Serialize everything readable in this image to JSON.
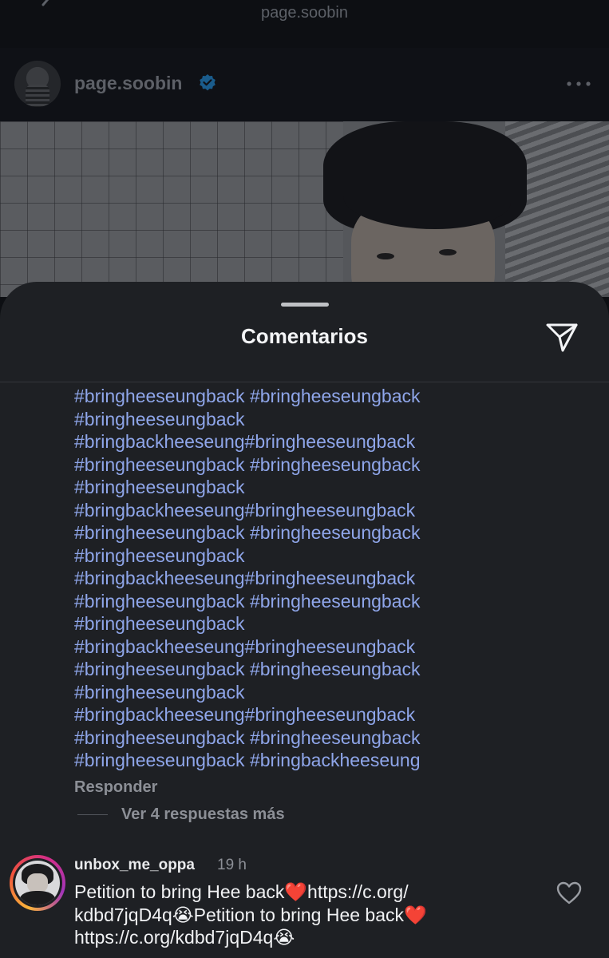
{
  "post": {
    "top_title": "page.soobin",
    "username": "page.soobin",
    "icons": {
      "back": "chevron-left-icon",
      "verified": "verified-badge-icon",
      "more": "more-options-icon"
    }
  },
  "comments_sheet": {
    "title": "Comentarios",
    "share_icon": "send-paper-plane-icon",
    "comment_1": {
      "lines": [
        "#bringheeseungback #bringheeseungback",
        "#bringheeseungback",
        "#bringbackheeseung#bringheeseungback",
        "#bringheeseungback #bringheeseungback",
        "#bringheeseungback",
        "#bringbackheeseung#bringheeseungback",
        "#bringheeseungback #bringheeseungback",
        "#bringheeseungback",
        "#bringbackheeseung#bringheeseungback",
        "#bringheeseungback #bringheeseungback",
        "#bringheeseungback",
        "#bringbackheeseung#bringheeseungback",
        "#bringheeseungback #bringheeseungback",
        "#bringheeseungback",
        "#bringbackheeseung#bringheeseungback",
        "#bringheeseungback #bringheeseungback",
        "#bringheeseungback #bringbackheeseung"
      ],
      "reply_label": "Responder",
      "view_replies_label": "Ver 4 respuestas más"
    },
    "comment_2": {
      "username": "unbox_me_oppa",
      "time": "19 h",
      "line_1_text": "Petition to bring Hee back",
      "line_1_emoji": "❤️",
      "line_1_link": "https://c.org/",
      "line_2_link": "kdbd7jqD4q",
      "line_2_emoji": "😭",
      "line_2_text": "Petition to bring Hee back",
      "line_2_emoji_2": "❤️",
      "line_3_link": "https://c.org/kdbd7jqD4q",
      "line_3_emoji": "😭",
      "like_icon": "heart-outline-icon"
    }
  },
  "colors": {
    "hashtag": "#8fa6ea",
    "sheet_bg": "#1e2024",
    "background": "#0d0f13",
    "secondary_text": "#8c8f96",
    "heart": "#e2202a",
    "verified": "#1d9bf0"
  }
}
